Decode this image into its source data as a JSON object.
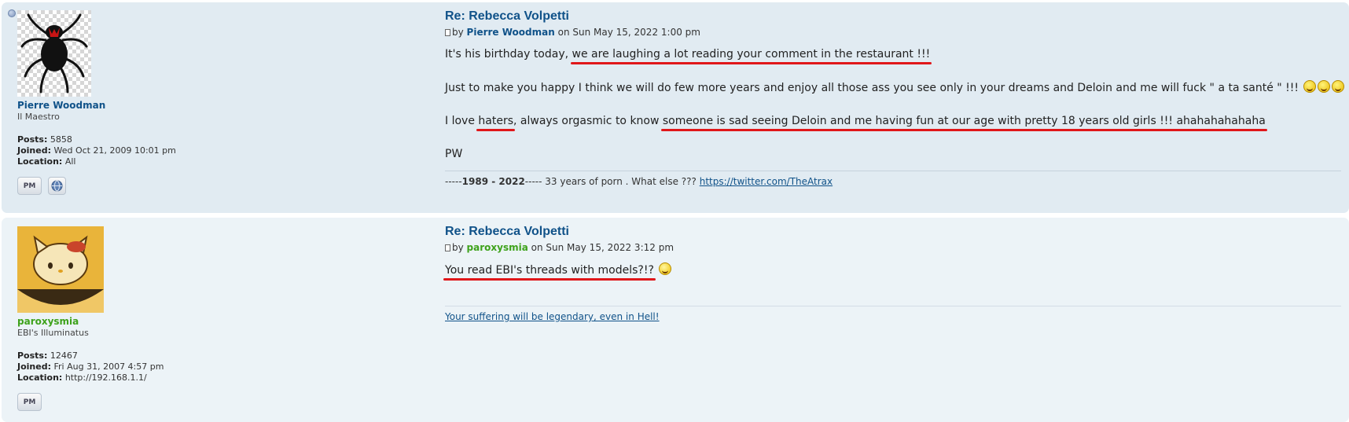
{
  "posts": [
    {
      "author": {
        "name": "Pierre Woodman",
        "rank": "Il Maestro",
        "posts_label": "Posts:",
        "posts": "5858",
        "joined_label": "Joined:",
        "joined": "Wed Oct 21, 2009 10:01 pm",
        "location_label": "Location:",
        "location": "All",
        "avatar_icon": "spider-icon",
        "name_color": "#105289"
      },
      "title": "Re: Rebecca Volpetti",
      "by": "by",
      "date": "on Sun May 15, 2022 1:00 pm",
      "content": {
        "p1_a": "It's his birthday today, ",
        "p1_b": "we are laughing a lot reading your comment in the restaurant !!!",
        "p2": "Just to make you happy I think we will do few more years and enjoy all those ass you see only in your dreams and Deloin and me will fuck \" a ta santé \" !!!",
        "p3_a": "I love ",
        "p3_b": "haters",
        "p3_c": ", always orgasmic to know ",
        "p3_d": "someone is sad seeing Deloin and me having fun at our age with pretty 18 years old girls !!! ahahahahahaha",
        "p4": "PW"
      },
      "signature": {
        "prefix": "-----",
        "years": "1989 - 2022",
        "middle": "----- 33 years of porn . What else ??? ",
        "link": "https://twitter.com/TheAtrax"
      },
      "contact": [
        "PM",
        "WWW"
      ]
    },
    {
      "author": {
        "name": "paroxysmia",
        "rank": "EBI's Illuminatus",
        "posts_label": "Posts:",
        "posts": "12467",
        "joined_label": "Joined:",
        "joined": "Fri Aug 31, 2007 4:57 pm",
        "location_label": "Location:",
        "location": "http://192.168.1.1/",
        "avatar_icon": "hello-kitty-avatar",
        "name_color": "#3ea21b"
      },
      "title": "Re: Rebecca Volpetti",
      "by": "by",
      "date": "on Sun May 15, 2022 3:12 pm",
      "content": {
        "p1": "You read EBI's threads with models?!?"
      },
      "signature": {
        "link": "Your suffering will be legendary, even in Hell!"
      },
      "contact": [
        "PM"
      ]
    }
  ],
  "colors": {
    "post_bg1": "#e1ebf2",
    "post_bg2": "#ecf3f7",
    "link": "#105289",
    "underline_markup": "#e0171a"
  }
}
